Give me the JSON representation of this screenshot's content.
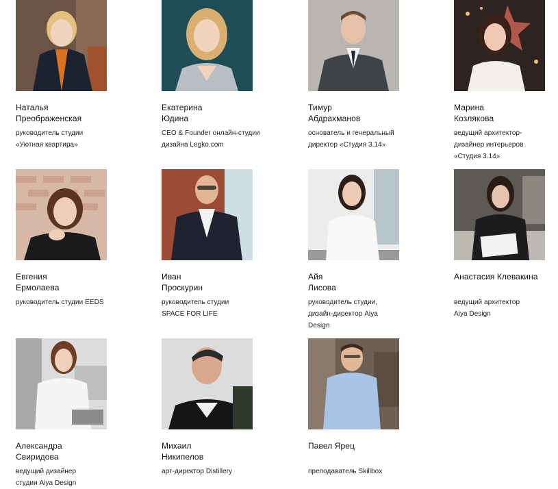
{
  "speakers": [
    {
      "name": [
        "Наталья",
        "Преображенская"
      ],
      "role": [
        "руководитель студии",
        "«Уютная квартира»"
      ],
      "photo": "speaker-photo-woman-blonde"
    },
    {
      "name": [
        "Екатерина",
        "Юдина"
      ],
      "role": [
        "CEO & Founder онлайн-студии",
        "дизайна Legko.com"
      ],
      "photo": "speaker-photo-woman-blonde"
    },
    {
      "name": [
        "Тимур",
        "Абдрахманов"
      ],
      "role": [
        "основатель и генеральный",
        "директор «Студия 3.14»"
      ],
      "photo": "speaker-photo-man-suit"
    },
    {
      "name": [
        "Марина",
        "Козлякова"
      ],
      "role": [
        "ведущий архитектор-",
        "дизайнер интерьеров",
        "«Студия 3.14»"
      ],
      "photo": "speaker-photo-woman-brunette"
    },
    {
      "name": [
        "Евгения",
        "Ермолаева"
      ],
      "role": [
        "руководитель студии EEDS"
      ],
      "photo": "speaker-photo-woman-brunette"
    },
    {
      "name": [
        "Иван",
        "Проскурин"
      ],
      "role": [
        "руководитель студии",
        "SPACE FOR LIFE"
      ],
      "photo": "speaker-photo-man-suit"
    },
    {
      "name": [
        "Айя",
        "Лисова"
      ],
      "role": [
        "руководитель студии,",
        "дизайн-директор Aiya",
        "Design"
      ],
      "photo": "speaker-photo-woman-brunette"
    },
    {
      "name": [
        "Анастасия Клевакина"
      ],
      "role": [
        "ведущий архитектор",
        "Aiya Design"
      ],
      "photo": "speaker-photo-woman-brunette"
    },
    {
      "name": [
        "Александра",
        "Свиридова"
      ],
      "role": [
        "ведущий дизайнер",
        "студии Aiya Design"
      ],
      "photo": "speaker-photo-woman-brunette"
    },
    {
      "name": [
        "Михаил",
        "Никипелов"
      ],
      "role": [
        "арт-директор Distillery"
      ],
      "photo": "speaker-photo-man-casual"
    },
    {
      "name": [
        "Павел Ярец"
      ],
      "role": [
        "преподаватель Skillbox"
      ],
      "photo": "speaker-photo-man-shirt"
    }
  ]
}
